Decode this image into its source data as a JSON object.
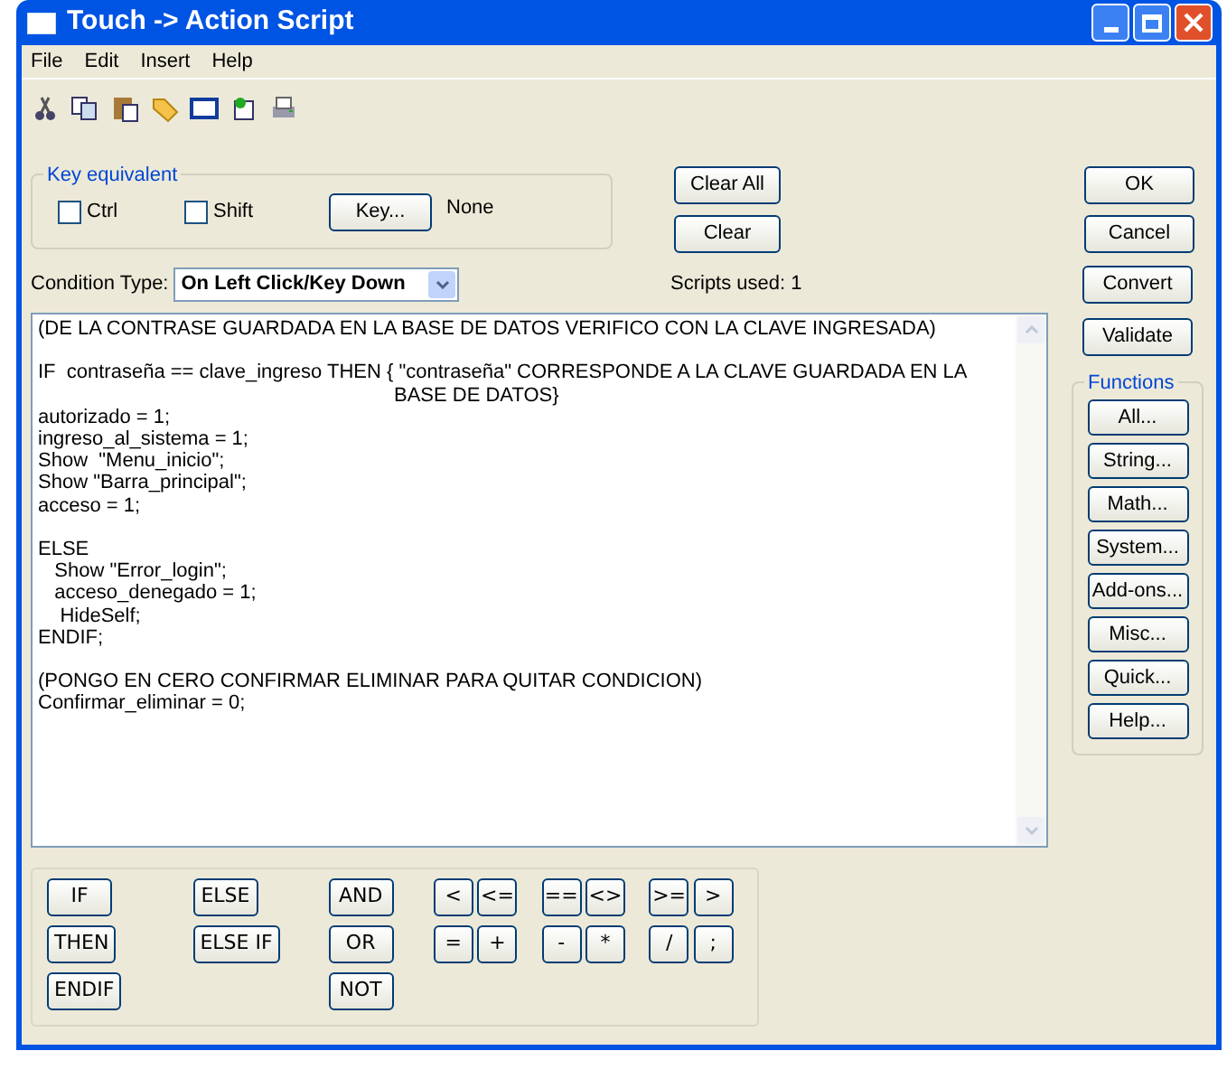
{
  "window": {
    "title": "Touch -> Action Script"
  },
  "menu": [
    "File",
    "Edit",
    "Insert",
    "Help"
  ],
  "key_equivalent": {
    "title": "Key equivalent",
    "checkboxes": [
      {
        "label": "Ctrl",
        "checked": false
      },
      {
        "label": "Shift",
        "checked": false
      }
    ],
    "key_button": "Key...",
    "key_value": "None"
  },
  "clear_buttons": [
    "Clear All",
    "Clear"
  ],
  "dialog_buttons": [
    "OK",
    "Cancel"
  ],
  "condition": {
    "label": "Condition Type:",
    "value": "On Left Click/Key Down"
  },
  "scripts_used": "Scripts used: 1",
  "side_buttons": [
    "Convert",
    "Validate"
  ],
  "functions": {
    "title": "Functions",
    "buttons": [
      "All...",
      "String...",
      "Math...",
      "System...",
      "Add-ons...",
      "Misc...",
      "Quick...",
      "Help..."
    ]
  },
  "script_lines": [
    {
      "kind": "code",
      "text": "(DE LA CONTRASE GUARDADA EN LA BASE DE DATOS VERIFICO CON LA CLAVE INGRESADA)"
    },
    {
      "kind": "blank"
    },
    {
      "kind": "code",
      "text": "IF  contraseña == clave_ingreso THEN { \"contraseña\" CORRESPONDE A LA CLAVE GUARDADA EN LA"
    },
    {
      "kind": "wrapped",
      "text": "BASE DE DATOS}"
    },
    {
      "kind": "code",
      "text": "autorizado = 1;"
    },
    {
      "kind": "code",
      "text": "ingreso_al_sistema = 1;"
    },
    {
      "kind": "code",
      "text": "Show  \"Menu_inicio\";"
    },
    {
      "kind": "code",
      "text": "Show \"Barra_principal\";"
    },
    {
      "kind": "code",
      "text": "acceso = 1;"
    },
    {
      "kind": "blank"
    },
    {
      "kind": "code",
      "text": "ELSE"
    },
    {
      "kind": "code",
      "text": "   Show \"Error_login\";"
    },
    {
      "kind": "code",
      "text": "   acceso_denegado = 1;"
    },
    {
      "kind": "code",
      "text": "    HideSelf;"
    },
    {
      "kind": "code",
      "text": "ENDIF;"
    },
    {
      "kind": "blank"
    },
    {
      "kind": "code",
      "text": "(PONGO EN CERO CONFIRMAR ELIMINAR PARA QUITAR CONDICION)"
    },
    {
      "kind": "code",
      "text": "Confirmar_eliminar = 0;"
    }
  ],
  "keyword_columns": [
    [
      "IF",
      "THEN",
      "ENDIF"
    ],
    [
      "ELSE",
      "ELSE IF"
    ],
    [
      "AND",
      "OR",
      "NOT"
    ]
  ],
  "operator_groups": [
    [
      "<",
      "<=",
      "=",
      "+"
    ],
    [
      "==",
      "<>",
      "-",
      "*"
    ],
    [
      ">=",
      ">",
      "/",
      ";"
    ]
  ]
}
